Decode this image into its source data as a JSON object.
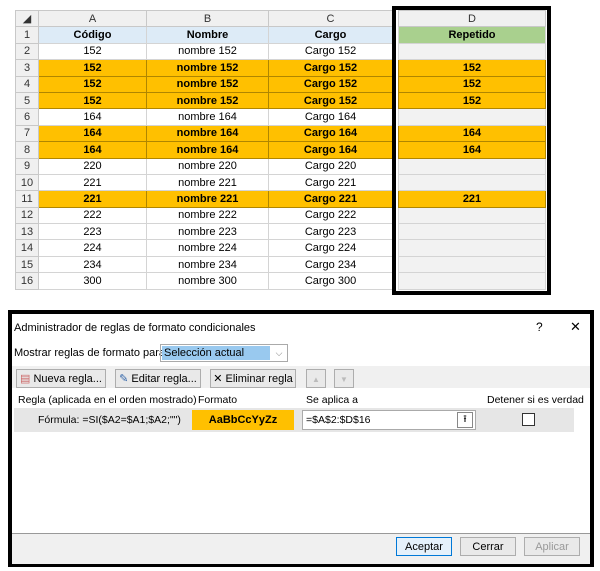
{
  "sheet": {
    "columns": [
      "A",
      "B",
      "C",
      "D"
    ],
    "headers": [
      "Código",
      "Nombre",
      "Cargo",
      "Repetido"
    ],
    "rows": [
      {
        "n": "2",
        "a": "152",
        "b": "nombre 152",
        "c": "Cargo 152",
        "d": "",
        "dup": false
      },
      {
        "n": "3",
        "a": "152",
        "b": "nombre 152",
        "c": "Cargo 152",
        "d": "152",
        "dup": true
      },
      {
        "n": "4",
        "a": "152",
        "b": "nombre 152",
        "c": "Cargo 152",
        "d": "152",
        "dup": true
      },
      {
        "n": "5",
        "a": "152",
        "b": "nombre 152",
        "c": "Cargo 152",
        "d": "152",
        "dup": true
      },
      {
        "n": "6",
        "a": "164",
        "b": "nombre 164",
        "c": "Cargo 164",
        "d": "",
        "dup": false
      },
      {
        "n": "7",
        "a": "164",
        "b": "nombre 164",
        "c": "Cargo 164",
        "d": "164",
        "dup": true
      },
      {
        "n": "8",
        "a": "164",
        "b": "nombre 164",
        "c": "Cargo 164",
        "d": "164",
        "dup": true
      },
      {
        "n": "9",
        "a": "220",
        "b": "nombre 220",
        "c": "Cargo 220",
        "d": "",
        "dup": false
      },
      {
        "n": "10",
        "a": "221",
        "b": "nombre 221",
        "c": "Cargo 221",
        "d": "",
        "dup": false
      },
      {
        "n": "11",
        "a": "221",
        "b": "nombre 221",
        "c": "Cargo 221",
        "d": "221",
        "dup": true
      },
      {
        "n": "12",
        "a": "222",
        "b": "nombre 222",
        "c": "Cargo 222",
        "d": "",
        "dup": false
      },
      {
        "n": "13",
        "a": "223",
        "b": "nombre 223",
        "c": "Cargo 223",
        "d": "",
        "dup": false
      },
      {
        "n": "14",
        "a": "224",
        "b": "nombre 224",
        "c": "Cargo 224",
        "d": "",
        "dup": false
      },
      {
        "n": "15",
        "a": "234",
        "b": "nombre 234",
        "c": "Cargo 234",
        "d": "",
        "dup": false
      },
      {
        "n": "16",
        "a": "300",
        "b": "nombre 300",
        "c": "Cargo 300",
        "d": "",
        "dup": false
      }
    ]
  },
  "dialog": {
    "title": "Administrador de reglas de formato condicionales",
    "help": "?",
    "close": "✕",
    "show_label": "Mostrar reglas de formato para:",
    "show_value": "Selección actual",
    "new_rule": "Nueva regla...",
    "edit_rule": "Editar regla...",
    "delete_rule": "Eliminar regla",
    "col_rule": "Regla (aplicada en el orden mostrado)",
    "col_format": "Formato",
    "col_applies": "Se aplica a",
    "col_stop": "Detener si es verdad",
    "rule_formula": "Fórmula: =SI($A2=$A1;$A2;\"\")",
    "format_preview": "AaBbCcYyZz",
    "applies_to": "=$A$2:$D$16",
    "ok": "Aceptar",
    "cancel": "Cerrar",
    "apply": "Aplicar"
  },
  "colors": {
    "highlight": "#ffc000",
    "header": "#ddebf7",
    "repeated_header": "#a9d08e"
  }
}
